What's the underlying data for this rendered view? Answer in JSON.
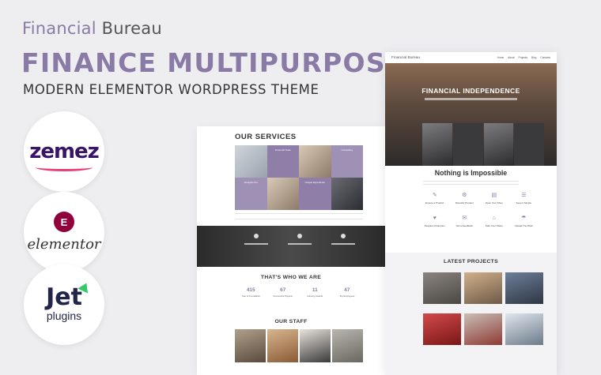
{
  "header": {
    "brand_part1": "Financial",
    "brand_part2": "Bureau",
    "headline": "FINANCE MULTIPURPOSE",
    "subline": "MODERN ELEMENTOR WORDPRESS THEME"
  },
  "logos": {
    "zemes": "zemez",
    "elementor_badge": "E",
    "elementor": "elementor",
    "jet": "Jet",
    "plugins": "plugins"
  },
  "mockup_left": {
    "services_title": "OUR SERVICES",
    "service_labels": [
      "Financial Tools",
      "Consulting",
      "Analytics Pro",
      "Unique Experience"
    ],
    "who_title": "THAT'S WHO WE ARE",
    "stats": [
      {
        "num": "415",
        "label": "Year of Foundation"
      },
      {
        "num": "67",
        "label": "Successful Projects"
      },
      {
        "num": "11",
        "label": "Industry Awards"
      },
      {
        "num": "47",
        "label": "Top Employees"
      }
    ],
    "staff_title": "OUR STAFF"
  },
  "mockup_right": {
    "brand": "Financial Bureau",
    "menu": [
      "Home",
      "About",
      "Projects",
      "Blog",
      "Contacts"
    ],
    "hero_title": "FINANCIAL INDEPENDENCE",
    "section_title": "Nothing is Impossible",
    "features": [
      {
        "icon": "✎",
        "label": "Ensure a Product"
      },
      {
        "icon": "⚙",
        "label": "Diversify Product"
      },
      {
        "icon": "▤",
        "label": "Open Your Shop"
      },
      {
        "icon": "☰",
        "label": "Keep it Simple"
      },
      {
        "icon": "♥",
        "label": "People's Champion"
      },
      {
        "icon": "✉",
        "label": "Get a Feedback"
      },
      {
        "icon": "⌂",
        "label": "Start Your Share"
      },
      {
        "icon": "☂",
        "label": "Upload The Work"
      }
    ],
    "projects_title": "LATEST PROJECTS"
  },
  "colors": {
    "accent": "#8a7aa6",
    "background": "#eeeef1"
  }
}
